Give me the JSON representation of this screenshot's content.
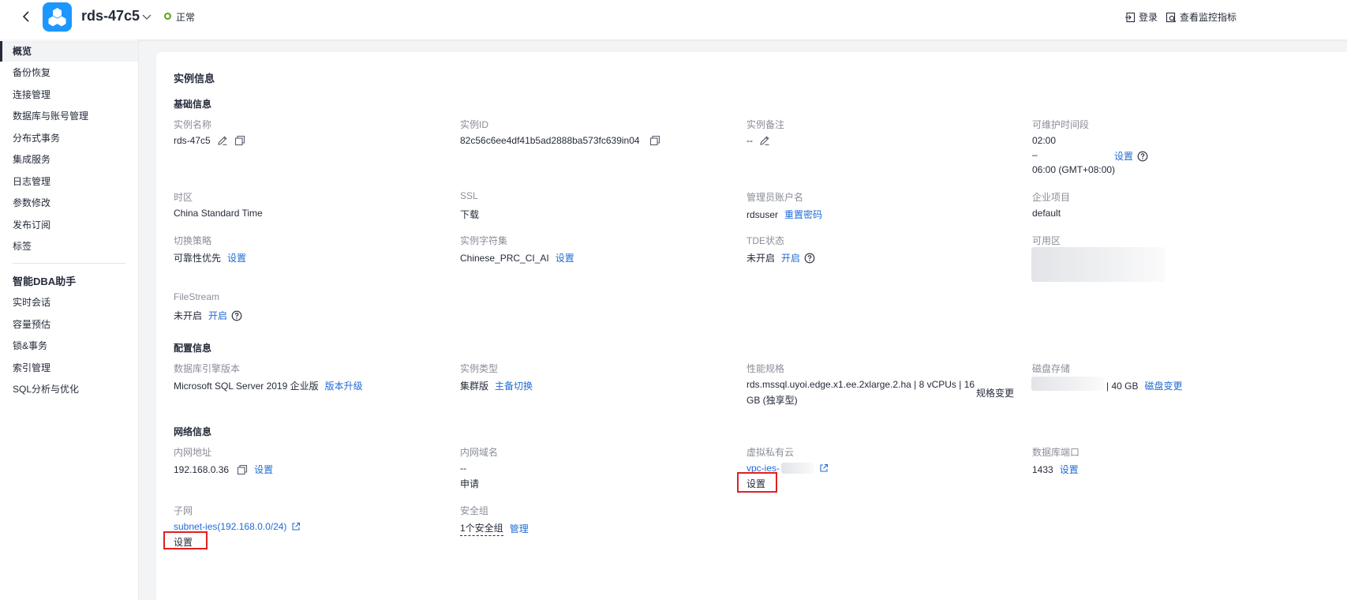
{
  "header": {
    "instance_name": "rds-47c5",
    "status": "正常",
    "login_label": "登录",
    "monitor_label": "查看监控指标",
    "colors": {
      "logo": "#1c97ff",
      "status_ok": "#5aa218",
      "link": "#1f6bd6"
    }
  },
  "sidebar": {
    "items": [
      {
        "label": "概览"
      },
      {
        "label": "备份恢复"
      },
      {
        "label": "连接管理"
      },
      {
        "label": "数据库与账号管理"
      },
      {
        "label": "分布式事务"
      },
      {
        "label": "集成服务"
      },
      {
        "label": "日志管理"
      },
      {
        "label": "参数修改"
      },
      {
        "label": "发布订阅"
      },
      {
        "label": "标签"
      }
    ],
    "dba_title": "智能DBA助手",
    "dba_items": [
      {
        "label": "实时会话"
      },
      {
        "label": "容量预估"
      },
      {
        "label": "锁&事务"
      },
      {
        "label": "索引管理"
      },
      {
        "label": "SQL分析与优化"
      }
    ]
  },
  "main": {
    "title": "实例信息",
    "basic": {
      "title": "基础信息",
      "instance_name_label": "实例名称",
      "instance_name": "rds-47c5",
      "instance_id_label": "实例ID",
      "instance_id": "82c56c6ee4df41b5ad2888ba573fc639in04",
      "remark_label": "实例备注",
      "remark": "--",
      "maint_label": "可维护时间段",
      "maint_start": "02:00",
      "maint_dash": "–",
      "maint_end": "06:00 (GMT+08:00)",
      "maint_set": "设置",
      "timezone_label": "时区",
      "timezone": "China Standard Time",
      "ssl_label": "SSL",
      "ssl_download": "下载",
      "admin_label": "管理员账户名",
      "admin": "rdsuser",
      "admin_reset": "重置密码",
      "project_label": "企业项目",
      "project": "default",
      "switch_label": "切换策略",
      "switch": "可靠性优先",
      "switch_set": "设置",
      "charset_label": "实例字符集",
      "charset": "Chinese_PRC_CI_AI",
      "charset_set": "设置",
      "tde_label": "TDE状态",
      "tde": "未开启",
      "tde_enable": "开启",
      "az_label": "可用区",
      "filestream_label": "FileStream",
      "filestream": "未开启",
      "filestream_enable": "开启"
    },
    "config": {
      "title": "配置信息",
      "engine_label": "数据库引擎版本",
      "engine": "Microsoft SQL Server 2019 企业版",
      "engine_upgrade": "版本升级",
      "type_label": "实例类型",
      "type": "集群版",
      "type_switch": "主备切换",
      "spec_label": "性能规格",
      "spec_line1": "rds.mssql.uyoi.edge.x1.ee.2xlarge.2.ha | 8 vCPUs | 16",
      "spec_line2": "GB (独享型)",
      "spec_change": "规格变更",
      "disk_label": "磁盘存储",
      "disk": "| 40 GB",
      "disk_change": "磁盘变更"
    },
    "network": {
      "title": "网络信息",
      "ip_label": "内网地址",
      "ip": "192.168.0.36",
      "ip_set": "设置",
      "domain_label": "内网域名",
      "domain": "--",
      "domain_apply": "申请",
      "vpc_label": "虚拟私有云",
      "vpc": "vpc-ies-",
      "vpc_set": "设置",
      "port_label": "数据库端口",
      "port": "1433",
      "port_set": "设置",
      "subnet_label": "子网",
      "subnet": "subnet-ies(192.168.0.0/24)",
      "subnet_set": "设置",
      "sg_label": "安全组",
      "sg": "1个安全组",
      "sg_manage": "管理"
    }
  }
}
